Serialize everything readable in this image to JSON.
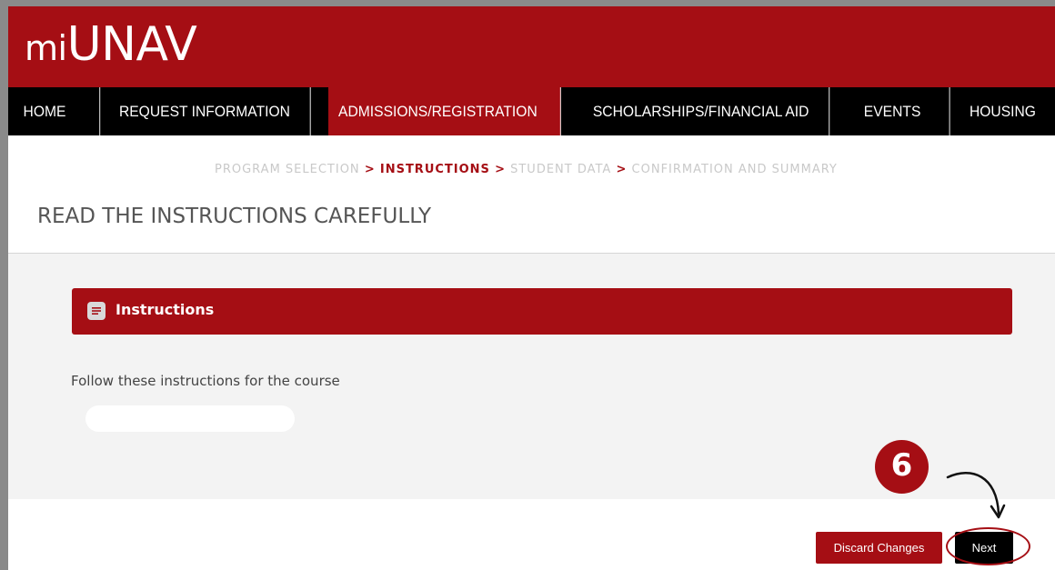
{
  "app": {
    "logo_prefix": "mi",
    "logo_main": "UNAV"
  },
  "nav": {
    "items": [
      {
        "label": "HOME",
        "active": false
      },
      {
        "label": "REQUEST INFORMATION",
        "active": false
      },
      {
        "label": "ADMISSIONS/REGISTRATION",
        "active": true
      },
      {
        "label": "SCHOLARSHIPS/FINANCIAL AID",
        "active": false
      },
      {
        "label": "EVENTS",
        "active": false
      },
      {
        "label": "HOUSING",
        "active": false
      }
    ]
  },
  "breadcrumb": {
    "step1": "PROGRAM SELECTION",
    "sep": ">",
    "step2": "INSTRUCTIONS",
    "step3": "STUDENT DATA",
    "step4": "CONFIRMATION AND SUMMARY"
  },
  "page": {
    "title": "READ THE INSTRUCTIONS CAREFULLY"
  },
  "panel": {
    "title": "Instructions",
    "icon": "document-icon",
    "body_text": "Follow these instructions for the course"
  },
  "annotation": {
    "step_number": "6"
  },
  "actions": {
    "discard_label": "Discard Changes",
    "next_label": "Next"
  },
  "colors": {
    "brand_red": "#a50e14",
    "nav_black": "#000000",
    "panel_bg": "#f3f3f3"
  }
}
